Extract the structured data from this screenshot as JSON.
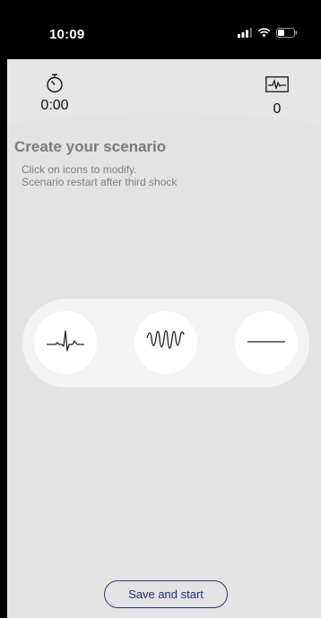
{
  "status_bar": {
    "time": "10:09"
  },
  "header": {
    "timer_value": "0:00",
    "shock_count": "0"
  },
  "scenario": {
    "title": "Create your scenario",
    "instruction_line1": "Click on icons to modify.",
    "instruction_line2": "Scenario restart after third shock"
  },
  "rhythms": [
    {
      "icon": "ecg-sinus-rhythm-icon"
    },
    {
      "icon": "ventricular-fibrillation-icon"
    },
    {
      "icon": "asystole-flatline-icon"
    }
  ],
  "footer": {
    "save_label": "Save and start"
  },
  "colors": {
    "background": "#e3e3e3",
    "pill": "#f3f3f3",
    "title_text": "#7a7a7a",
    "button_border": "#2a3a7a"
  }
}
